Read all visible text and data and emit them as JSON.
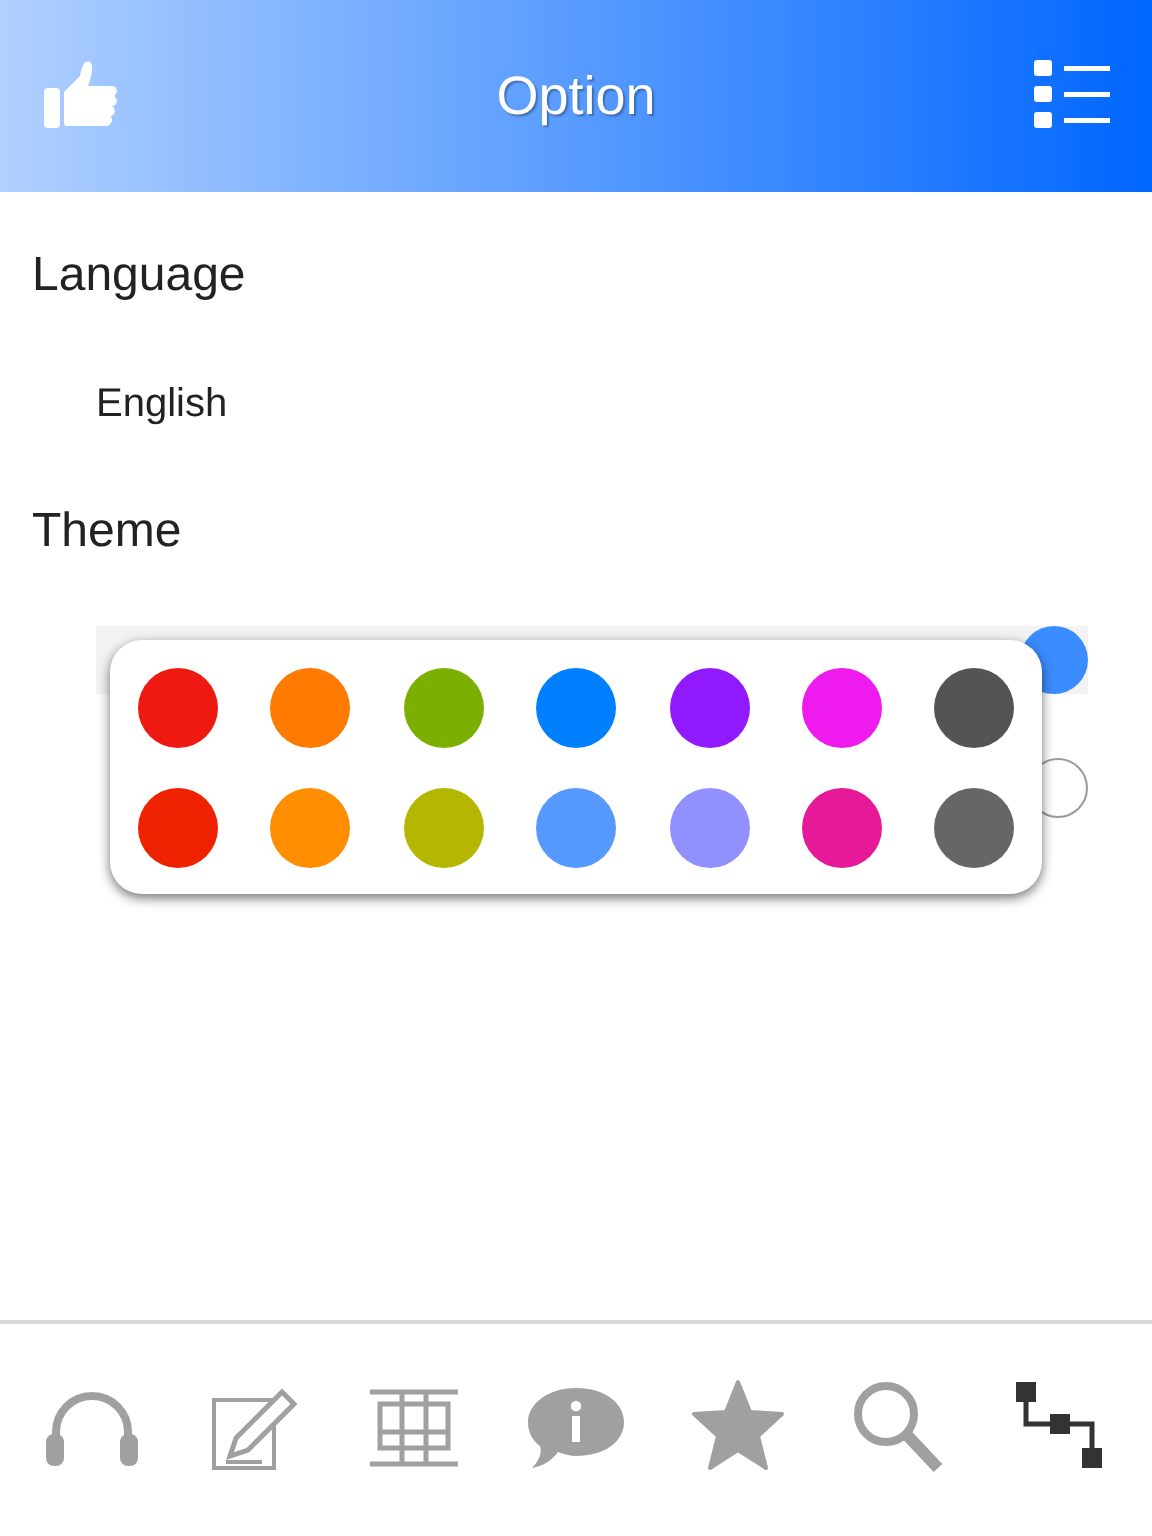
{
  "header": {
    "title": "Option"
  },
  "sections": [
    {
      "heading": "Language",
      "rows": [
        {
          "kind": "text",
          "label": "English"
        }
      ]
    },
    {
      "heading": "Theme",
      "rows": [
        {
          "kind": "color",
          "color": "#3a8cff"
        },
        {
          "kind": "radio",
          "selected": false
        }
      ]
    }
  ],
  "palette": [
    {
      "color": "#ee1a11"
    },
    {
      "color": "#ff7a00"
    },
    {
      "color": "#7cb000"
    },
    {
      "color": "#0080ff"
    },
    {
      "color": "#9019ff"
    },
    {
      "color": "#ee1aee"
    },
    {
      "color": "#545454"
    },
    {
      "color": "#ee2200"
    },
    {
      "color": "#ff8d00"
    },
    {
      "color": "#b4b600"
    },
    {
      "color": "#5599ff"
    },
    {
      "color": "#9090ff"
    },
    {
      "color": "#e61a99"
    },
    {
      "color": "#666666"
    }
  ],
  "tabs": [
    {
      "kind": "headphones",
      "selected": false
    },
    {
      "kind": "edit",
      "selected": false
    },
    {
      "kind": "grid",
      "selected": false
    },
    {
      "kind": "info",
      "selected": false
    },
    {
      "kind": "star",
      "selected": false
    },
    {
      "kind": "search",
      "selected": false
    },
    {
      "kind": "flow",
      "selected": true
    }
  ]
}
